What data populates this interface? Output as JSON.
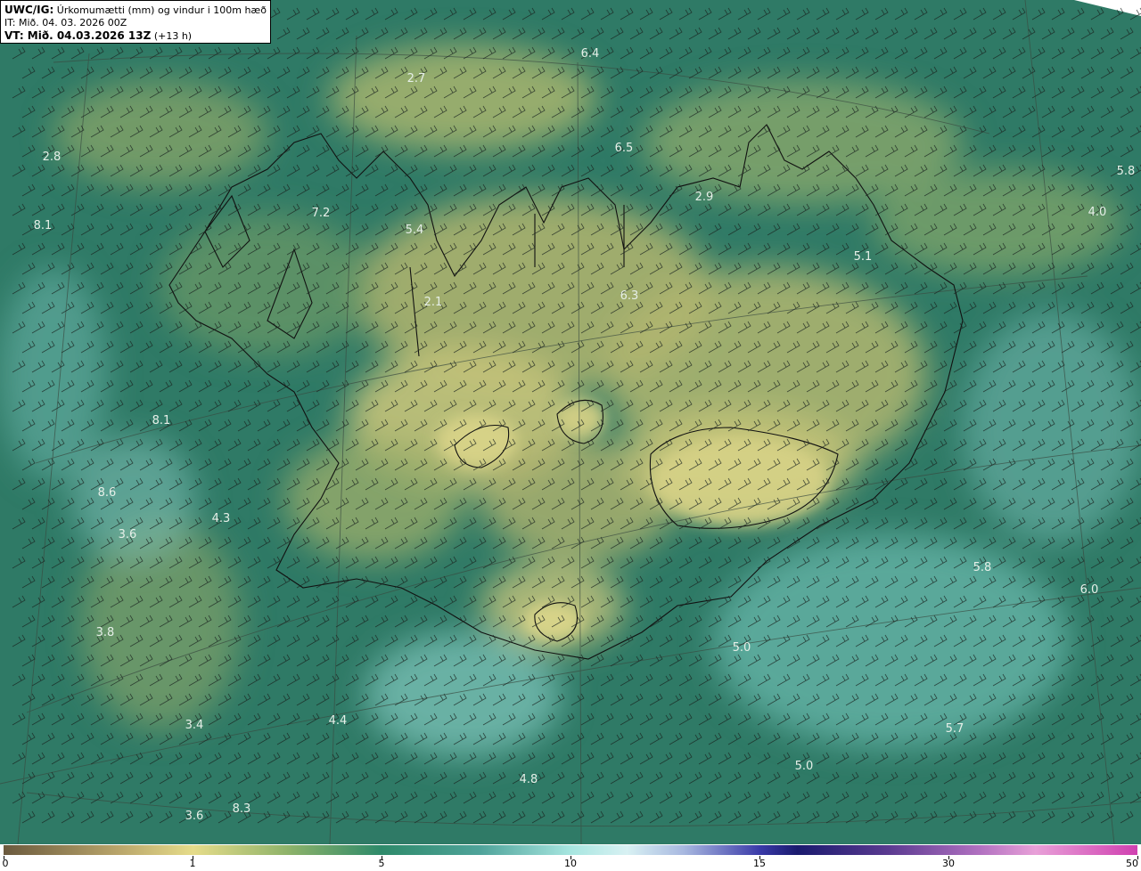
{
  "title": {
    "product": "UWC/IG:",
    "description": "Úrkomumætti (mm) og vindur i 100m hæð",
    "initial_time": "IT: Mið. 04. 03. 2026 00Z",
    "valid_time_label": "VT: Mið. 04.03.2026 13Z",
    "lead": "(+13 h)"
  },
  "map_labels": [
    {
      "text": "6.4"
    },
    {
      "text": "2.7"
    },
    {
      "text": "6.5"
    },
    {
      "text": "5.8"
    },
    {
      "text": "2.8"
    },
    {
      "text": "2.9"
    },
    {
      "text": "4.0"
    },
    {
      "text": "8.1"
    },
    {
      "text": "7.2"
    },
    {
      "text": "5.4"
    },
    {
      "text": "5.1"
    },
    {
      "text": "6.3"
    },
    {
      "text": "2.1"
    },
    {
      "text": "8.1"
    },
    {
      "text": "8.6"
    },
    {
      "text": "4.3"
    },
    {
      "text": "3.6"
    },
    {
      "text": "5.8"
    },
    {
      "text": "6.0"
    },
    {
      "text": "3.8"
    },
    {
      "text": "5.0"
    },
    {
      "text": "3.4"
    },
    {
      "text": "4.4"
    },
    {
      "text": "5.7"
    },
    {
      "text": "5.0"
    },
    {
      "text": "4.8"
    },
    {
      "text": "3.6"
    },
    {
      "text": "8.3"
    }
  ],
  "colorbar": {
    "ticks": [
      {
        "label": "0",
        "pos": 0
      },
      {
        "label": "1",
        "pos": 0.1667
      },
      {
        "label": "5",
        "pos": 0.3333
      },
      {
        "label": "10",
        "pos": 0.5
      },
      {
        "label": "15",
        "pos": 0.6667
      },
      {
        "label": "30",
        "pos": 0.8333
      },
      {
        "label": "50",
        "pos": 1
      }
    ]
  },
  "colors": {
    "sea_base": "#2f7a66",
    "land_low": "#c9c57d",
    "land_mid": "#7da46a",
    "wet": "#7fc7c0",
    "coast": "#111111"
  }
}
